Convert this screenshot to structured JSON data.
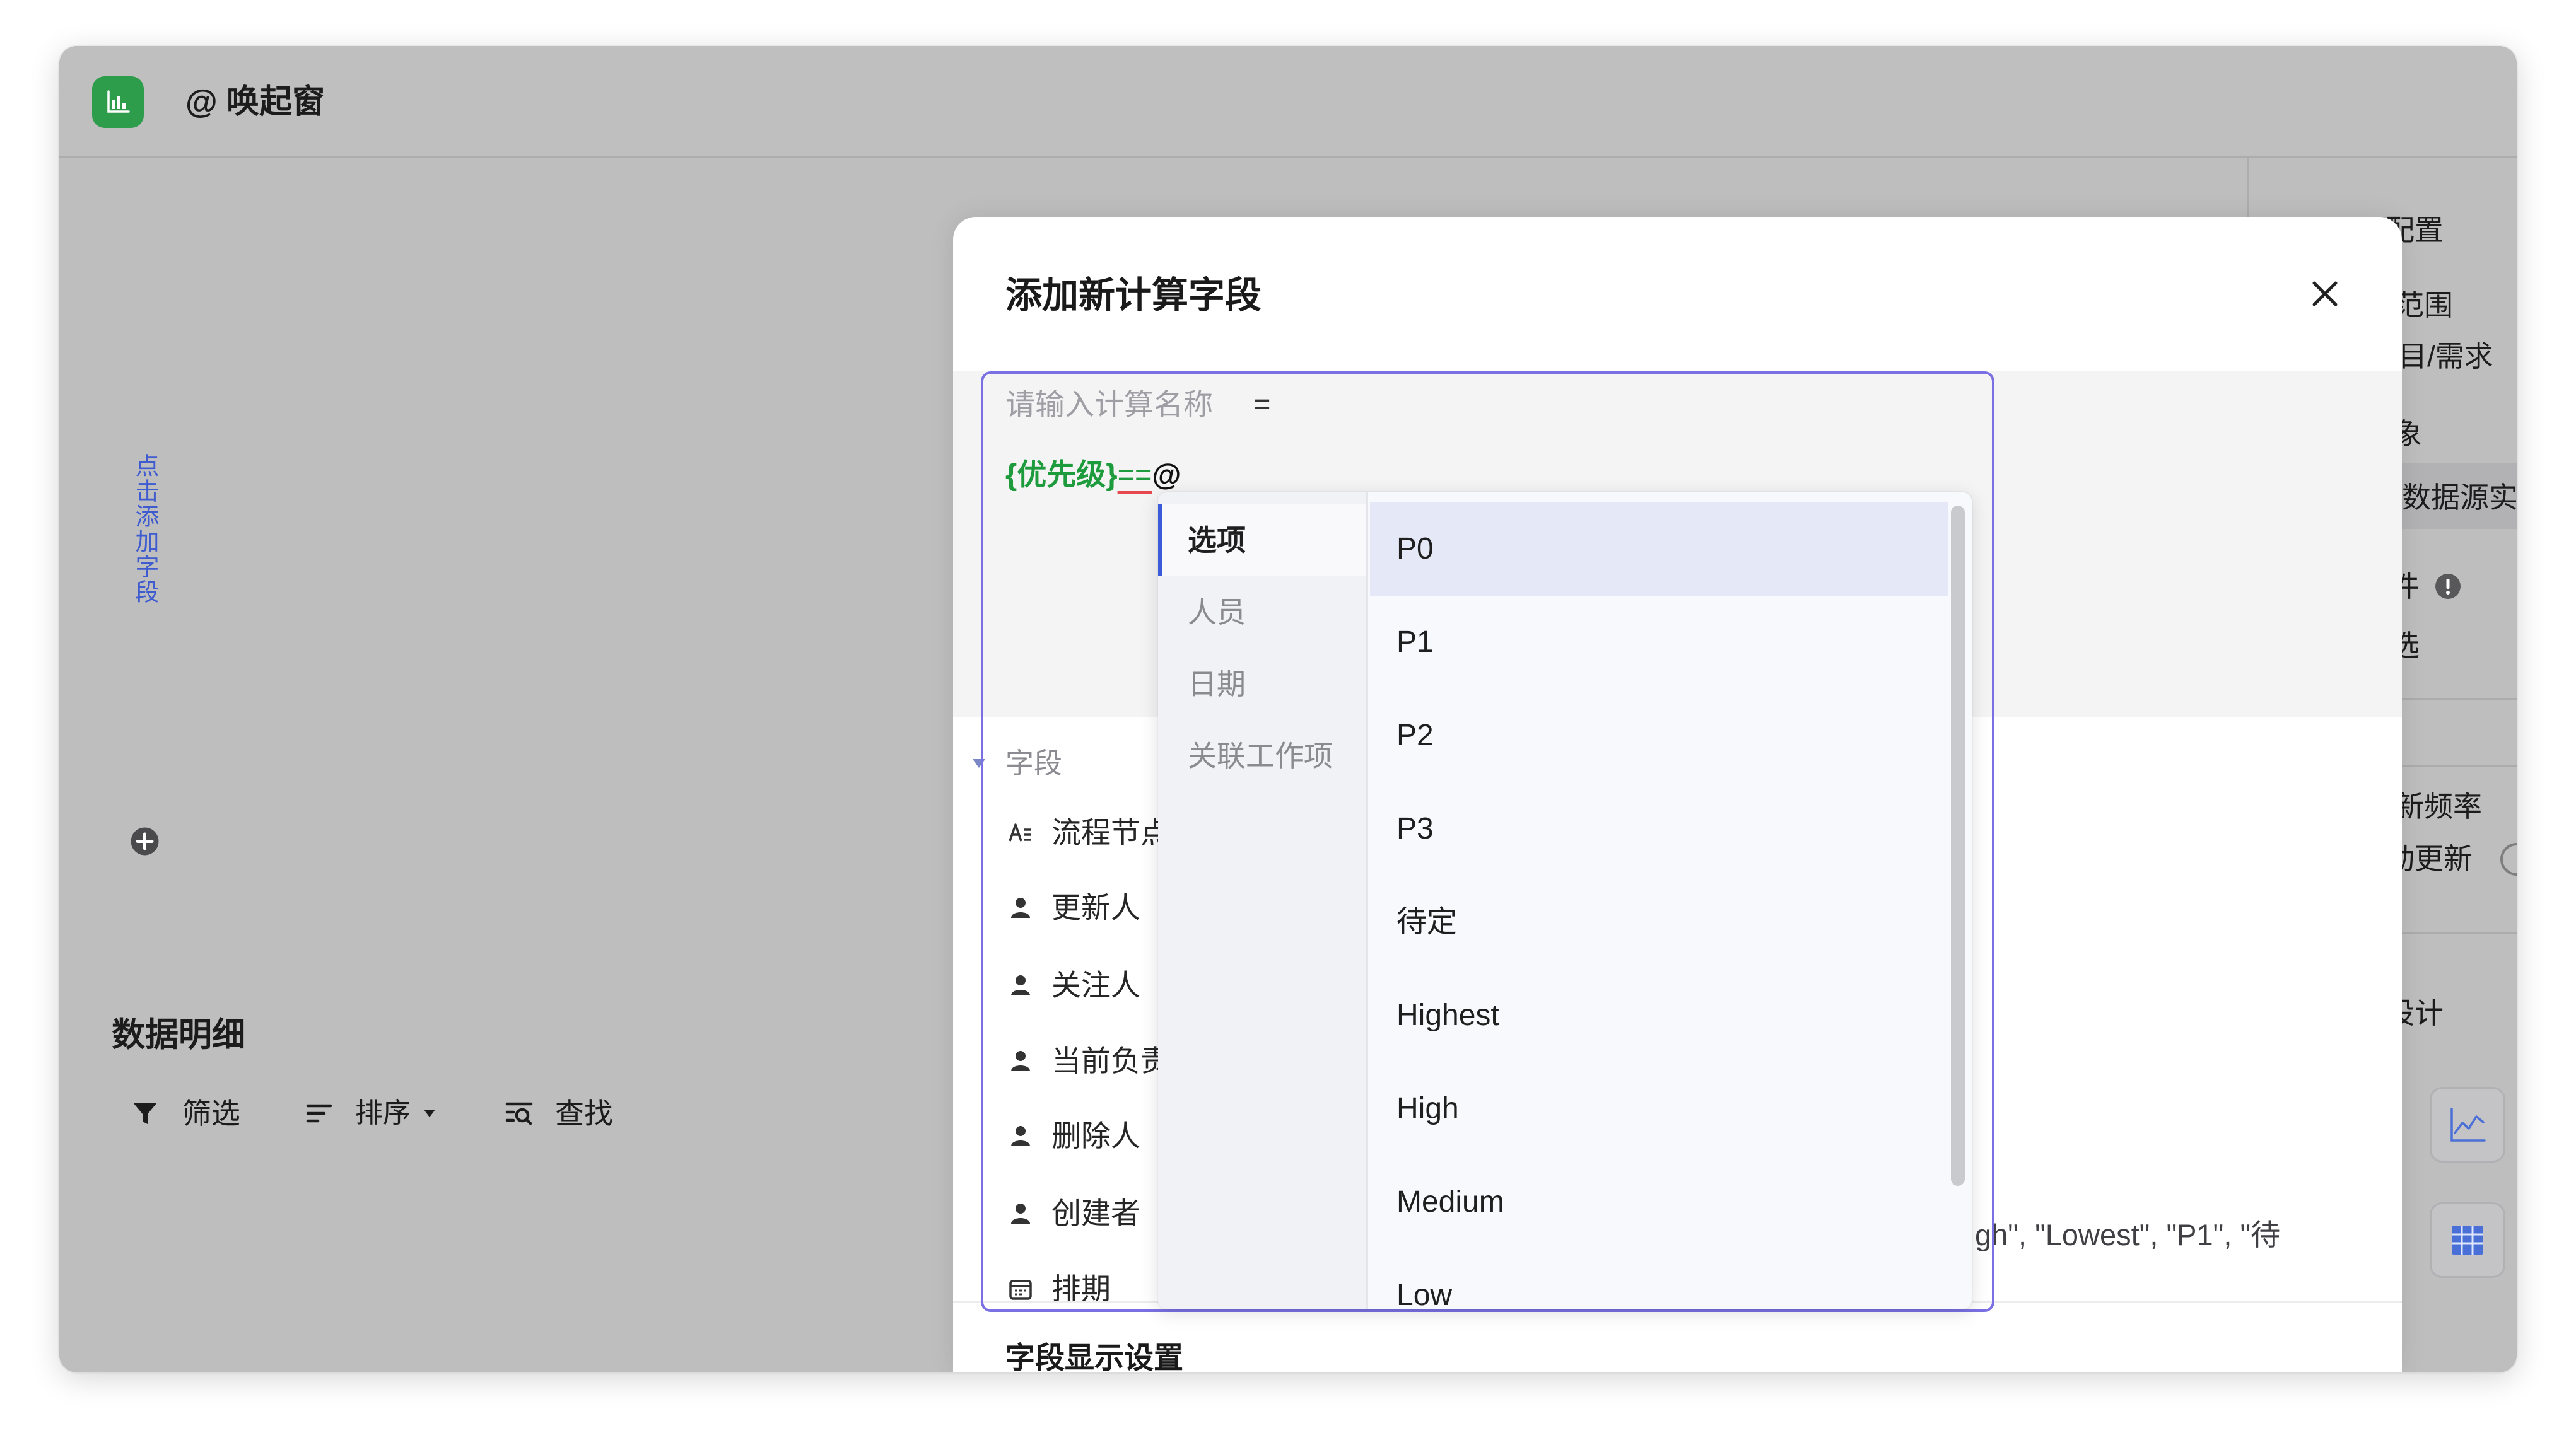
{
  "window": {
    "title": "@ 唤起窗",
    "app_icon": "bar-chart-icon"
  },
  "sidebar": {
    "add_field_text": "点击添加字段",
    "add_icon": "plus-circle-icon"
  },
  "details": {
    "title": "数据明细",
    "toolbar": {
      "filter": {
        "label": "筛选",
        "icon": "filter-icon"
      },
      "sort": {
        "label": "排序",
        "icon": "sort-icon",
        "caret_icon": "caret-down-icon"
      },
      "find": {
        "label": "查找",
        "icon": "find-icon"
      }
    }
  },
  "config_panel": {
    "items": [
      "配置",
      "范围",
      "目/需求",
      "象",
      "数据源实例",
      "件",
      "选",
      "新频率",
      "动更新",
      "设计"
    ],
    "selected_item_index": 4,
    "info_icon": "info-icon",
    "chart_types": [
      "line-chart-icon",
      "table-icon"
    ]
  },
  "modal": {
    "title": "添加新计算字段",
    "close_icon": "close-icon",
    "name_placeholder": "请输入计算名称",
    "equals_sign": "=",
    "formula": {
      "field": "{优先级}",
      "operator": "==",
      "trigger": "@"
    },
    "fields_group": {
      "label": "字段",
      "expanded": true
    },
    "fields": [
      {
        "label": "流程节点",
        "icon": "text-field-icon"
      },
      {
        "label": "更新人",
        "icon": "person-icon"
      },
      {
        "label": "关注人",
        "icon": "person-icon"
      },
      {
        "label": "当前负责",
        "icon": "person-icon"
      },
      {
        "label": "删除人",
        "icon": "person-icon"
      },
      {
        "label": "创建者",
        "icon": "person-icon"
      },
      {
        "label": "排期",
        "icon": "calendar-icon"
      }
    ],
    "description_fragment": "gh\", \"Lowest\", \"P1\", \"待",
    "display_settings_title": "字段显示设置"
  },
  "mention_dropdown": {
    "categories": [
      "选项",
      "人员",
      "日期",
      "关联工作项"
    ],
    "selected_category_index": 0,
    "options": [
      "P0",
      "P1",
      "P2",
      "P3",
      "待定",
      "Highest",
      "High",
      "Medium",
      "Low"
    ],
    "highlighted_option_index": 0
  },
  "colors": {
    "accent": "#3b5bdb",
    "focus_border": "#7a70e3",
    "formula_green": "#1e9b3c",
    "error_underline": "#e5484d",
    "app_icon_green": "#2d9d4c",
    "option_highlight": "#e5e8f6",
    "backdrop_gray": "#bebebf"
  }
}
